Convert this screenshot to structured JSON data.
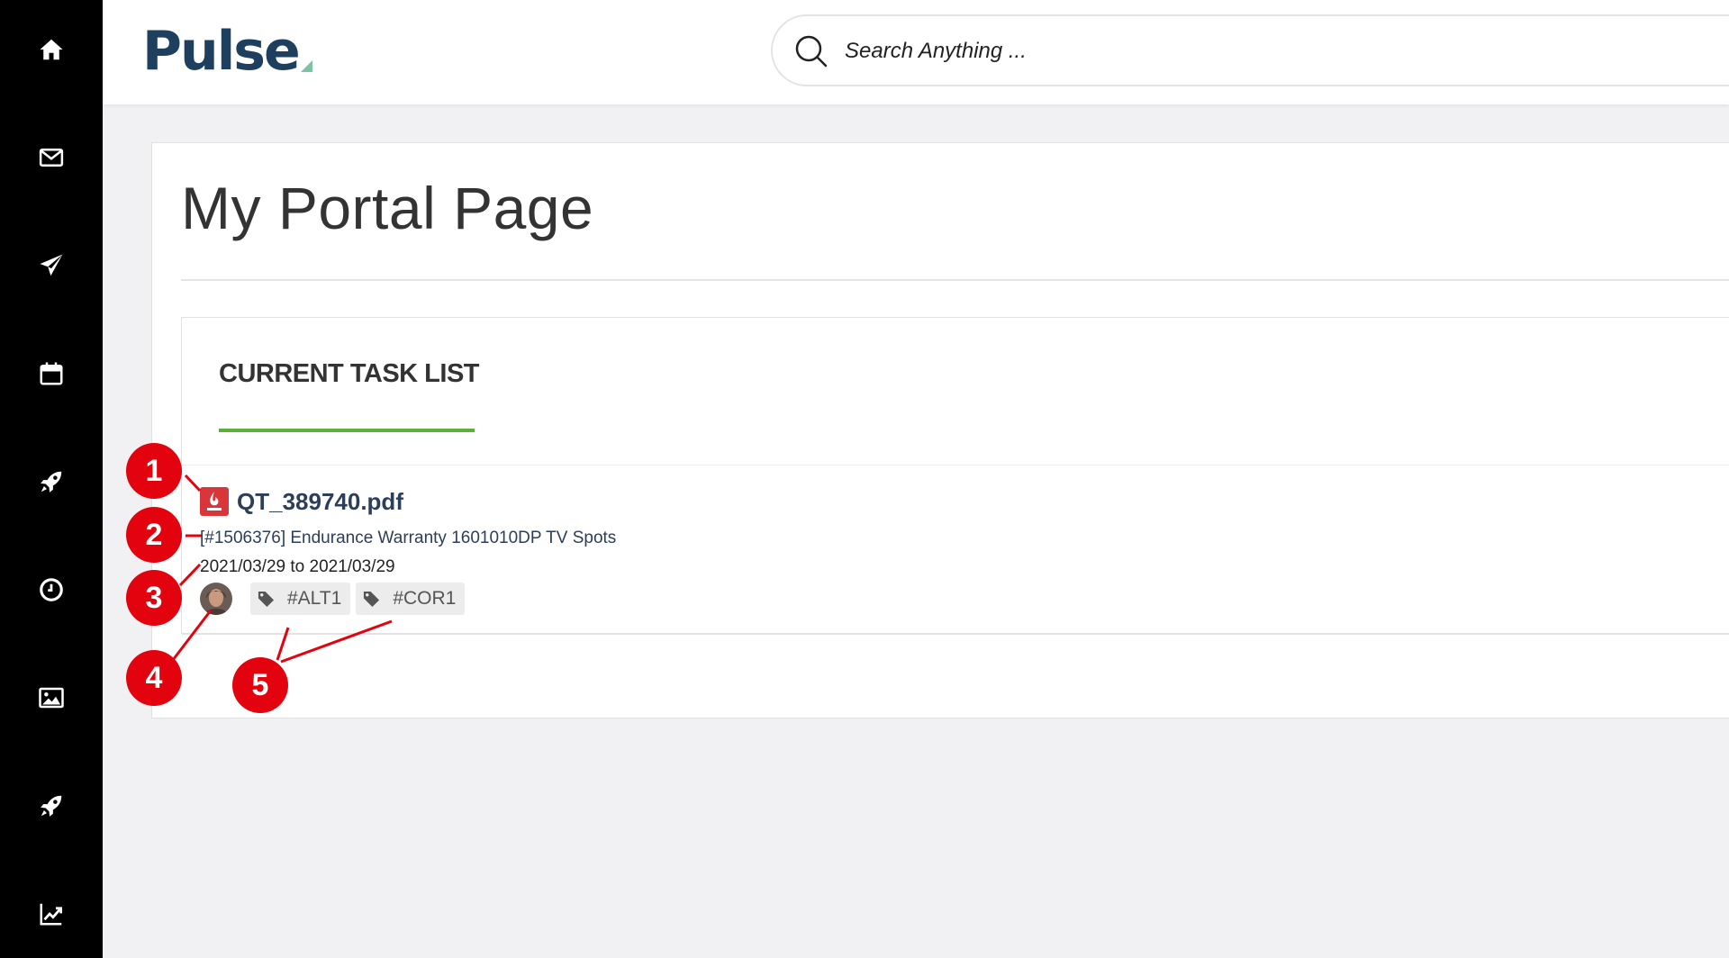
{
  "sidebar": {
    "items": [
      {
        "icon": "home-icon",
        "name": "sidebar-item-home"
      },
      {
        "icon": "mail-icon",
        "name": "sidebar-item-mail"
      },
      {
        "icon": "send-icon",
        "name": "sidebar-item-send"
      },
      {
        "icon": "calendar-icon",
        "name": "sidebar-item-calendar"
      },
      {
        "icon": "rocket-icon",
        "name": "sidebar-item-projects"
      },
      {
        "icon": "clock-icon",
        "name": "sidebar-item-time"
      },
      {
        "icon": "image-icon",
        "name": "sidebar-item-media"
      },
      {
        "icon": "rocket-icon",
        "name": "sidebar-item-launch"
      },
      {
        "icon": "chart-line-icon",
        "name": "sidebar-item-reports"
      }
    ]
  },
  "header": {
    "logo_text": "Pulse",
    "search_placeholder": "Search Anything ..."
  },
  "page": {
    "title": "My Portal Page"
  },
  "task_list": {
    "title": "CURRENT TASK LIST",
    "accent_color": "#5bb03a",
    "tasks": [
      {
        "file_icon": "pdf-file-icon",
        "filename": "QT_389740.pdf",
        "project": "[#1506376] Endurance Warranty 1601010DP TV Spots",
        "dates": "2021/03/29 to 2021/03/29",
        "tags": [
          "#ALT1",
          "#COR1"
        ]
      }
    ]
  },
  "callouts": {
    "labels": [
      "1",
      "2",
      "3",
      "4",
      "5"
    ],
    "color": "#e2030f"
  }
}
